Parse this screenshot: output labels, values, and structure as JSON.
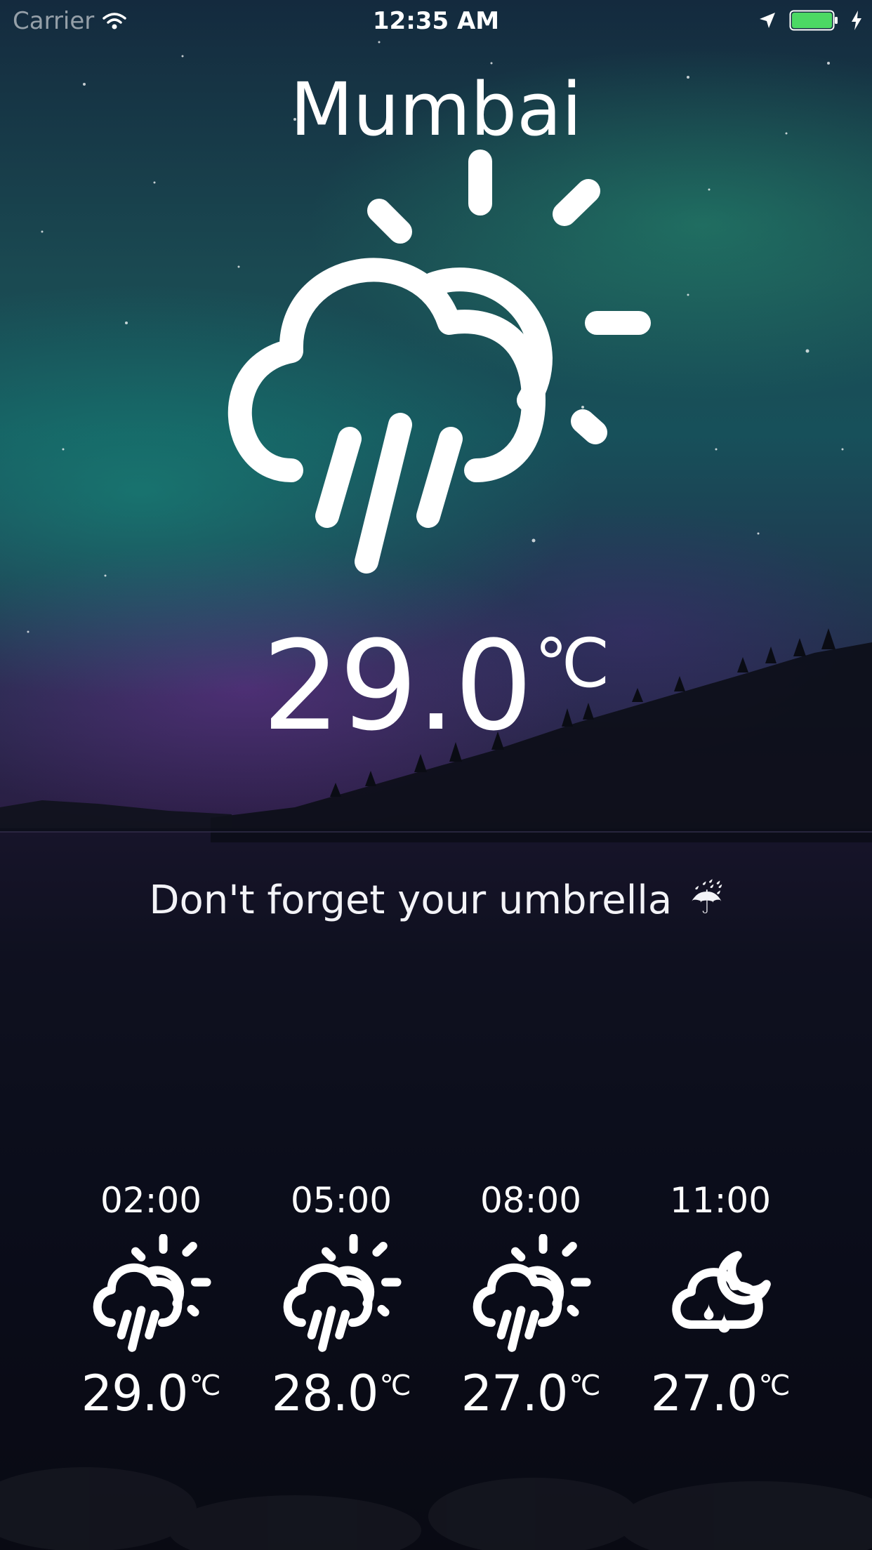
{
  "status_bar": {
    "carrier": "Carrier",
    "time": "12:35 AM",
    "battery_color": "#4cd964",
    "icons": [
      "wifi-icon",
      "location-arrow-icon",
      "battery-icon",
      "charging-bolt-icon"
    ]
  },
  "weather": {
    "city": "Mumbai",
    "condition_icon": "rain-sun-cloud-icon",
    "temperature": "29.0",
    "unit": "℃",
    "message": "Don't forget your umbrella",
    "message_emoji": "☔"
  },
  "forecast": [
    {
      "time": "02:00",
      "icon": "rain-sun-cloud-icon",
      "temperature": "29.0",
      "unit": "℃"
    },
    {
      "time": "05:00",
      "icon": "rain-sun-cloud-icon",
      "temperature": "28.0",
      "unit": "℃"
    },
    {
      "time": "08:00",
      "icon": "rain-sun-cloud-icon",
      "temperature": "27.0",
      "unit": "℃"
    },
    {
      "time": "11:00",
      "icon": "cloud-moon-drizzle-icon",
      "temperature": "27.0",
      "unit": "℃"
    }
  ],
  "colors": {
    "sky_top": "#142a3e",
    "aurora_green": "#1a8a7a",
    "aurora_purple": "#6e3296",
    "text": "#ffffff"
  }
}
